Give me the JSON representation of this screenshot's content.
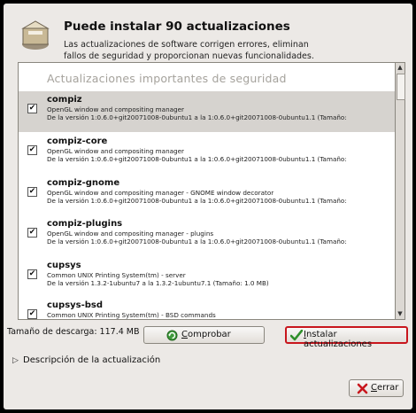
{
  "header": {
    "title": "Puede instalar 90 actualizaciones",
    "description_line1": "Las actualizaciones de software corrigen errores, eliminan",
    "description_line2": "fallos de seguridad y proporcionan nuevas funcionalidades."
  },
  "section_title": "Actualizaciones importantes de seguridad",
  "items": [
    {
      "name": "compiz",
      "summary": "OpenGL window and compositing manager",
      "version": "De la versión 1:0.6.0+git20071008-0ubuntu1 a la 1:0.6.0+git20071008-0ubuntu1.1 (Tamaño:",
      "checked": "✔"
    },
    {
      "name": "compiz-core",
      "summary": "OpenGL window and compositing manager",
      "version": "De la versión 1:0.6.0+git20071008-0ubuntu1 a la 1:0.6.0+git20071008-0ubuntu1.1 (Tamaño:",
      "checked": "✔"
    },
    {
      "name": "compiz-gnome",
      "summary": "OpenGL window and compositing manager - GNOME window decorator",
      "version": "De la versión 1:0.6.0+git20071008-0ubuntu1 a la 1:0.6.0+git20071008-0ubuntu1.1 (Tamaño:",
      "checked": "✔"
    },
    {
      "name": "compiz-plugins",
      "summary": "OpenGL window and compositing manager - plugins",
      "version": "De la versión 1:0.6.0+git20071008-0ubuntu1 a la 1:0.6.0+git20071008-0ubuntu1.1 (Tamaño:",
      "checked": "✔"
    },
    {
      "name": "cupsys",
      "summary": "Common UNIX Printing System(tm) - server",
      "version": "De la versión 1.3.2-1ubuntu7 a la 1.3.2-1ubuntu7.1 (Tamaño: 1.0 MB)",
      "checked": "✔"
    },
    {
      "name": "cupsys-bsd",
      "summary": "Common UNIX Printing System(tm) - BSD commands",
      "version": "",
      "checked": "✔"
    }
  ],
  "download_size": "Tamaño de descarga: 117.4 MB",
  "buttons": {
    "check_mnemonic": "C",
    "check_rest": "omprobar",
    "install_mnemonic": "I",
    "install_rest": "nstalar actualizaciones",
    "close_mnemonic": "C",
    "close_rest": "errar"
  },
  "expander_label": "Descripción de la actualización",
  "icons": {
    "header": "software-update-icon",
    "check": "refresh-icon",
    "install": "checkmark-icon",
    "close": "close-x-icon"
  },
  "colors": {
    "highlight": "#c8161d",
    "selected_row": "#d6d3cf"
  }
}
